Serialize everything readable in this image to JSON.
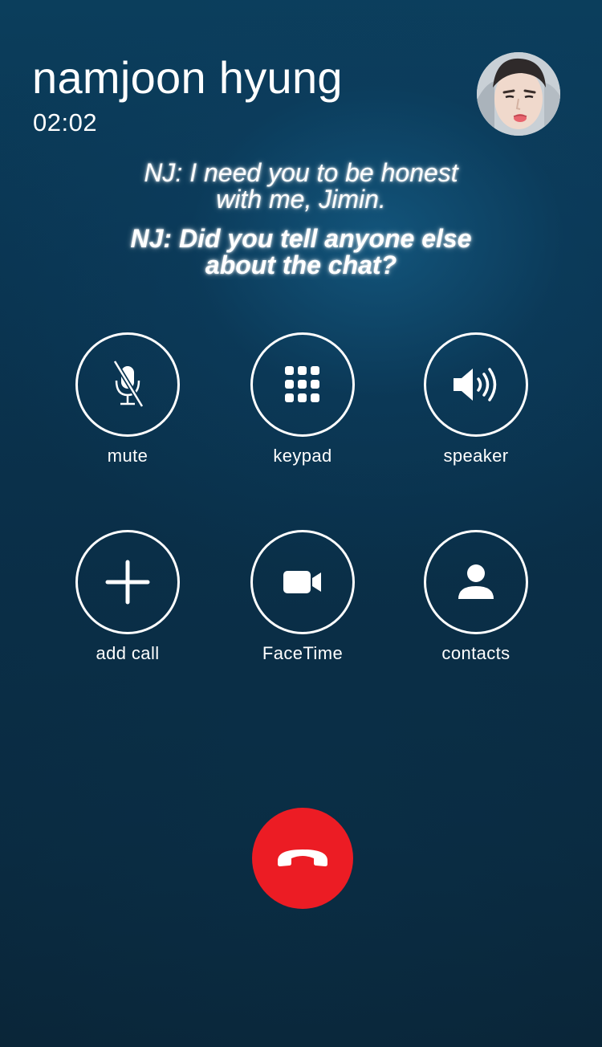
{
  "call": {
    "name": "namjoon hyung",
    "timer": "02:02"
  },
  "captions": [
    {
      "line_a": "NJ: I need you to be honest",
      "line_b": "with me, Jimin."
    },
    {
      "line_a": "NJ: Did you tell anyone else",
      "line_b": "about the chat?"
    }
  ],
  "controls": [
    {
      "label": "mute",
      "icon": "mic-muted-icon"
    },
    {
      "label": "keypad",
      "icon": "keypad-icon"
    },
    {
      "label": "speaker",
      "icon": "speaker-icon"
    },
    {
      "label": "add call",
      "icon": "plus-icon"
    },
    {
      "label": "FaceTime",
      "icon": "video-camera-icon"
    },
    {
      "label": "contacts",
      "icon": "person-icon"
    }
  ],
  "end_call": {
    "icon": "end-call-icon",
    "color": "#ec1c24"
  },
  "colors": {
    "background": "#0a3552",
    "text": "#ffffff",
    "end_call": "#ec1c24"
  }
}
